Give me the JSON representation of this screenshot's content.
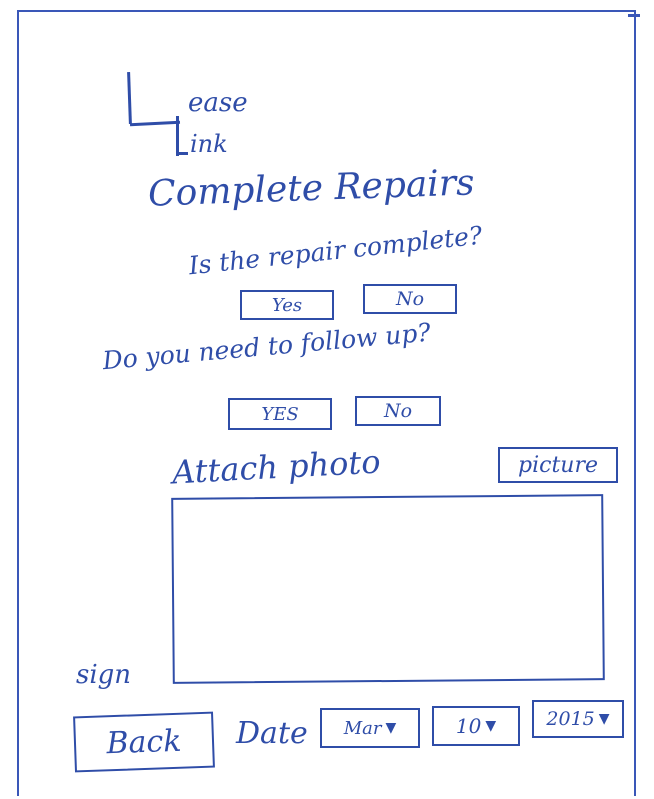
{
  "app": {
    "logo_word1": "ease",
    "logo_word2": "ink",
    "title": "Complete Repairs"
  },
  "repair": {
    "question": "Is the repair complete?",
    "yes_label": "Yes",
    "no_label": "No"
  },
  "followup": {
    "question": "Do you need to follow up?",
    "yes_label": "YES",
    "no_label": "No"
  },
  "attach": {
    "label": "Attach photo",
    "button_label": "picture"
  },
  "signature": {
    "label": "sign"
  },
  "footer": {
    "back_label": "Back",
    "date_label": "Date",
    "month_value": "Mar",
    "day_value": "10",
    "year_value": "2015",
    "dropdown_icon": "dropdown-triangle-icon"
  },
  "colors": {
    "ink": "#2f4da8"
  }
}
